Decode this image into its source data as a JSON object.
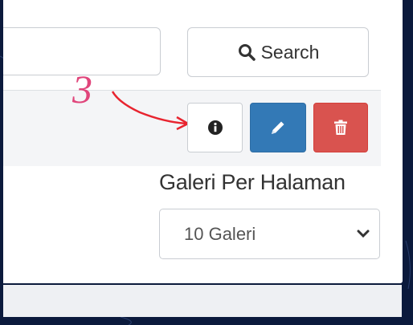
{
  "search": {
    "button_label": "Search",
    "icon": "search-icon"
  },
  "row_actions": {
    "info_icon": "info-icon",
    "edit_icon": "pencil-icon",
    "delete_icon": "trash-icon"
  },
  "annotation": {
    "number": "3"
  },
  "per_page": {
    "label": "Galeri Per Halaman",
    "selected": "10 Galeri"
  },
  "colors": {
    "edit": "#3379b6",
    "delete": "#d9534f",
    "annotation": "#e0457b",
    "background": "#0b1a3c"
  }
}
